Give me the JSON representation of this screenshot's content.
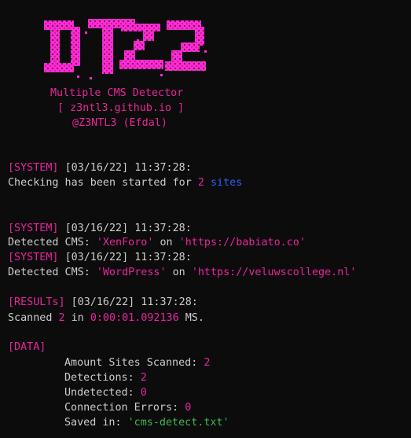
{
  "banner": {
    "logo_text": "DTZ2",
    "subtitle": "Multiple CMS Detector",
    "link": "[ z3ntl3.github.io ]",
    "author": "@Z3NTL3 (Efdal)"
  },
  "colors": {
    "background": "#0c0c0c",
    "magenta": "#e9259c",
    "logo_magenta": "#ff2bd1",
    "blue": "#2f5dff",
    "green": "#3fb94d",
    "text": "#cccccc"
  },
  "log": {
    "system1_tag": "[SYSTEM]",
    "system1_time": "[03/16/22] 11:37:28:",
    "checking_prefix": "Checking has been started for ",
    "checking_count": "2",
    "checking_suffix": "sites",
    "system2_tag": "[SYSTEM]",
    "system2_time": "[03/16/22] 11:37:28:",
    "detect1_prefix": "Detected CMS: ",
    "detect1_cms": "'XenForo'",
    "detect1_on": " on ",
    "detect1_url": "'https://babiato.co'",
    "system3_tag": "[SYSTEM]",
    "system3_time": "[03/16/22] 11:37:28:",
    "detect2_prefix": "Detected CMS: ",
    "detect2_cms": "'WordPress'",
    "detect2_on": " on ",
    "detect2_url": "'https://veluwscollege.nl'",
    "results_tag": "[RESULTs]",
    "results_time": "[03/16/22] 11:37:28:",
    "scanned_prefix": "Scanned ",
    "scanned_count": "2",
    "scanned_in": " in ",
    "scanned_time": "0:00:01.092136",
    "scanned_unit": " MS."
  },
  "data_section": {
    "tag": "[DATA]",
    "amount_label": "Amount Sites Scanned: ",
    "amount_value": "2",
    "detections_label": "Detections: ",
    "detections_value": "2",
    "undetected_label": "Undetected: ",
    "undetected_value": "0",
    "errors_label": "Connection Errors: ",
    "errors_value": "0",
    "saved_label": "Saved in: ",
    "saved_value": "'cms-detect.txt'"
  }
}
